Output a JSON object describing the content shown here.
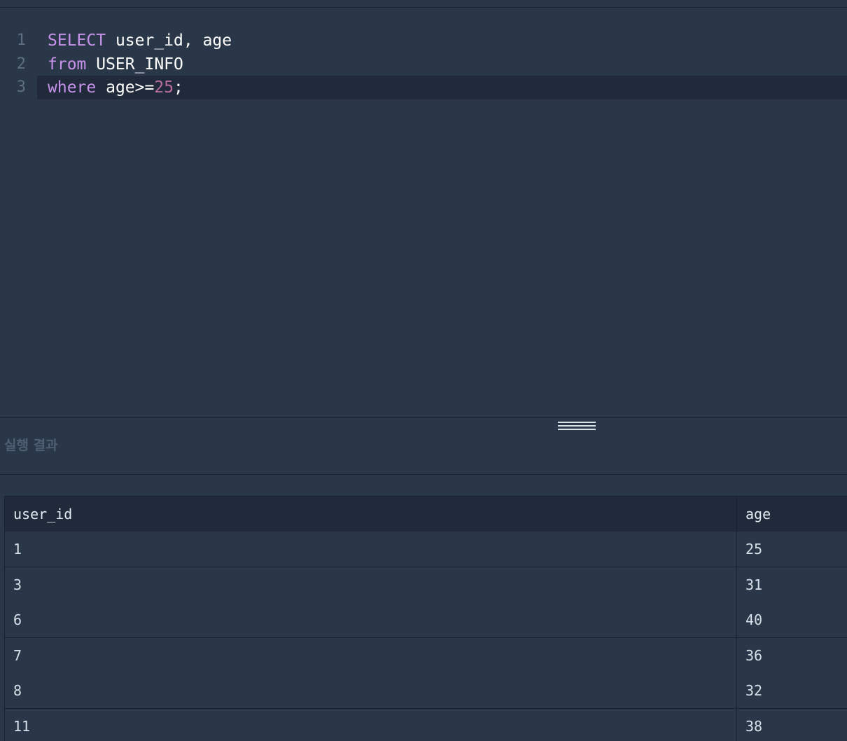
{
  "editor": {
    "lines": [
      {
        "number": "1",
        "tokens": [
          {
            "text": "SELECT",
            "kind": "keyword"
          },
          {
            "text": " user_id, age",
            "kind": "plain"
          }
        ]
      },
      {
        "number": "2",
        "tokens": [
          {
            "text": "from",
            "kind": "keyword"
          },
          {
            "text": " USER_INFO",
            "kind": "plain"
          }
        ]
      },
      {
        "number": "3",
        "tokens": [
          {
            "text": "where",
            "kind": "keyword"
          },
          {
            "text": " age>=",
            "kind": "plain"
          },
          {
            "text": "25",
            "kind": "number"
          },
          {
            "text": ";",
            "kind": "plain"
          }
        ]
      }
    ],
    "active_line": 3,
    "colors": {
      "keyword": "#c792ea",
      "number": "#b86f9f",
      "plain": "#ffffff"
    }
  },
  "results": {
    "title": "실행 결과",
    "columns": [
      "user_id",
      "age"
    ],
    "rows": [
      [
        "1",
        "25"
      ],
      [
        "3",
        "31"
      ],
      [
        "6",
        "40"
      ],
      [
        "7",
        "36"
      ],
      [
        "8",
        "32"
      ],
      [
        "11",
        "38"
      ]
    ]
  },
  "colors": {
    "background": "#2a3748",
    "active_line_bg": "#202a3b",
    "border": "#172334",
    "text": "#d7e0e9"
  }
}
